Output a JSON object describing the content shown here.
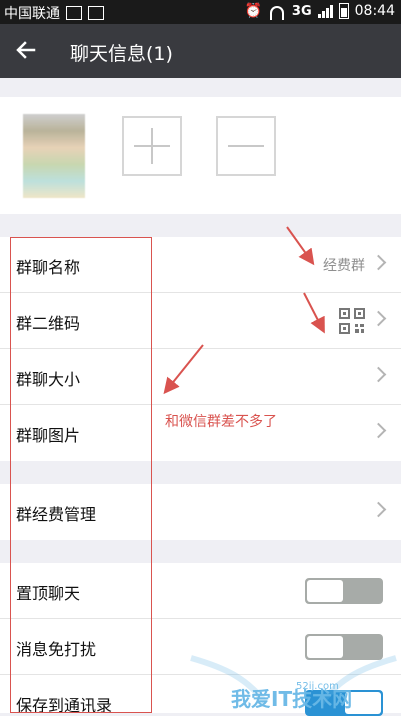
{
  "status_bar": {
    "carrier": "中国联通",
    "network": "3G",
    "time": "08:44",
    "icons": [
      "notification-icon",
      "image-icon",
      "alarm-icon",
      "wifi-icon",
      "signal-icon",
      "battery-icon"
    ]
  },
  "header": {
    "title": "聊天信息(1)",
    "back_icon": "back-arrow-icon"
  },
  "members": {
    "add_icon": "plus-icon",
    "remove_icon": "minus-icon"
  },
  "settings": {
    "group1": [
      {
        "label": "群聊名称",
        "value": "经费群"
      },
      {
        "label": "群二维码",
        "icon": "qr-code-icon"
      },
      {
        "label": "群聊大小",
        "value": ""
      },
      {
        "label": "群聊图片",
        "value": ""
      }
    ],
    "group2": [
      {
        "label": "群经费管理",
        "value": ""
      }
    ],
    "group3": [
      {
        "label": "置顶聊天",
        "toggle_on": false
      },
      {
        "label": "消息免打扰",
        "toggle_on": false
      },
      {
        "label": "保存到通讯录",
        "toggle_on": true
      }
    ]
  },
  "annotation": {
    "text": "和微信群差不多了",
    "color": "#d9534f"
  },
  "watermark": {
    "text": "我爱IT技术网",
    "sub": "52ij.com"
  },
  "colors": {
    "header_bg": "#393a3f",
    "status_bg": "#1a1a1a",
    "page_bg": "#efeff4",
    "accent": "#2a92d4"
  }
}
